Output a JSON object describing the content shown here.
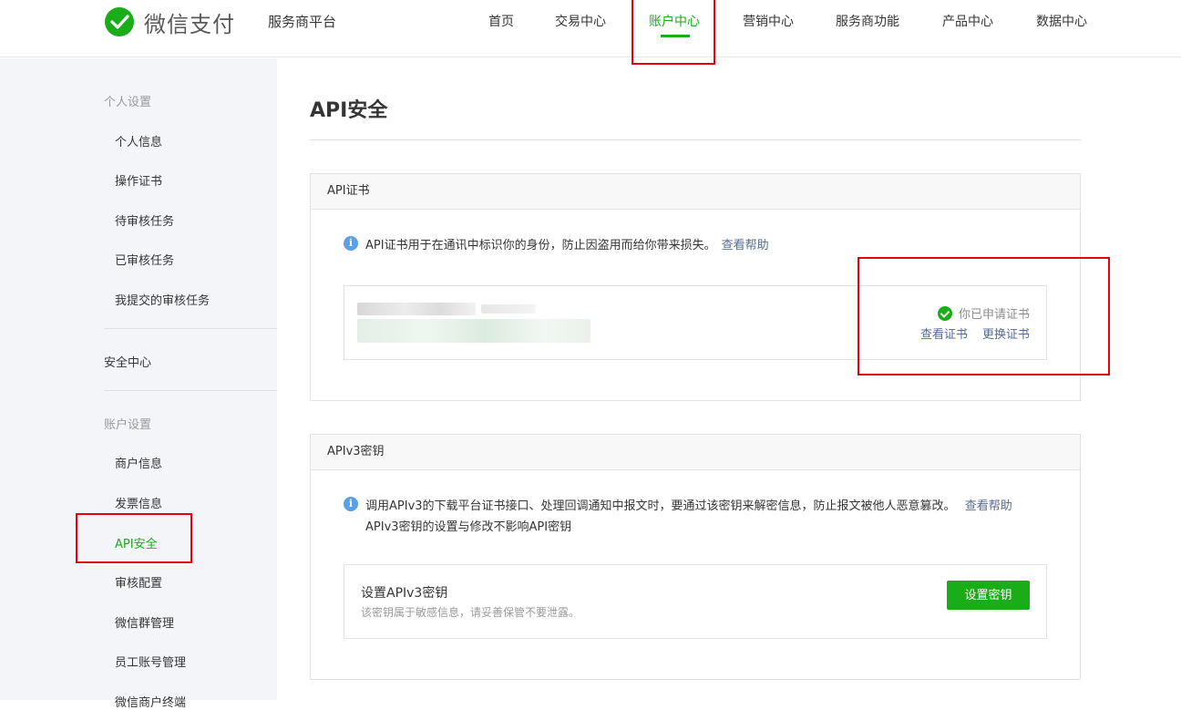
{
  "header": {
    "logo_text": "微信支付",
    "platform": "服务商平台",
    "nav": [
      {
        "label": "首页"
      },
      {
        "label": "交易中心"
      },
      {
        "label": "账户中心",
        "active": true
      },
      {
        "label": "营销中心"
      },
      {
        "label": "服务商功能"
      },
      {
        "label": "产品中心"
      },
      {
        "label": "数据中心"
      }
    ]
  },
  "sidebar": {
    "group_personal": "个人设置",
    "personal_items": [
      "个人信息",
      "操作证书",
      "待审核任务",
      "已审核任务",
      "我提交的审核任务"
    ],
    "security_center": "安全中心",
    "group_account": "账户设置",
    "account_items": [
      "商户信息",
      "发票信息",
      "API安全",
      "审核配置",
      "微信群管理",
      "员工账号管理",
      "微信商户终端"
    ],
    "active_item": "API安全"
  },
  "main": {
    "title": "API安全",
    "cert_panel": {
      "header": "API证书",
      "info": "API证书用于在通讯中标识你的身份，防止因盗用而给你带来损失。",
      "help_link": "查看帮助",
      "status": "你已申请证书",
      "view_link": "查看证书",
      "replace_link": "更换证书"
    },
    "apiv3_panel": {
      "header": "APIv3密钥",
      "info_line1": "调用APIv3的下载平台证书接口、处理回调通知中报文时，要通过该密钥来解密信息，防止报文被他人恶意篡改。",
      "help_link": "查看帮助",
      "info_line2": "APIv3密钥的设置与修改不影响API密钥",
      "key_title": "设置APIv3密钥",
      "key_desc": "该密钥属于敏感信息，请妥善保管不要泄露。",
      "set_button": "设置密钥"
    }
  },
  "colors": {
    "brand_green": "#1aad19",
    "link_blue": "#576b95",
    "highlight_red": "#e60012",
    "sidebar_bg": "#f4f5f9"
  }
}
